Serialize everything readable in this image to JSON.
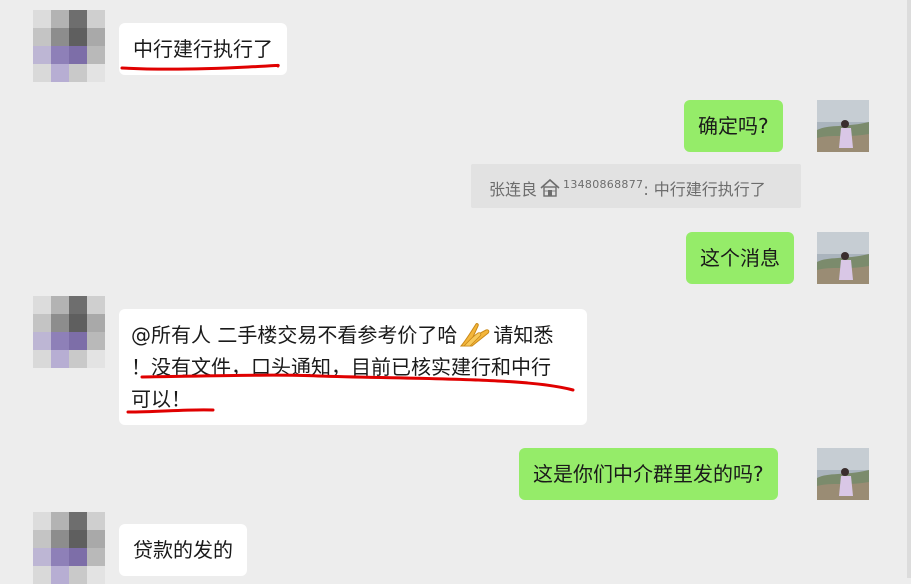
{
  "chat": {
    "messages": [
      {
        "side": "in",
        "text": "中行建行执行了"
      },
      {
        "side": "out",
        "text": "确定吗?"
      },
      {
        "side": "quote",
        "name": "张连良",
        "phone": "13480868877",
        "text": ": 中行建行执行了"
      },
      {
        "side": "out",
        "text": "这个消息"
      },
      {
        "side": "in",
        "line1_a": "@所有人 二手楼交易不看参考价了哈",
        "line1_b": "请知悉",
        "line2": "！没有文件，口头通知，目前已核实建行和中行",
        "line3": "可以！"
      },
      {
        "side": "out",
        "text": "这是你们中介群里发的吗?"
      },
      {
        "side": "in",
        "text": "贷款的发的"
      }
    ]
  },
  "icons": {
    "house": "house-icon",
    "hands": "folded-hands-emoji"
  },
  "colors": {
    "background": "#ededed",
    "bubble_in": "#ffffff",
    "bubble_out": "#95ec69",
    "quote_bg": "#e2e2e2",
    "annotation": "#e00000"
  }
}
